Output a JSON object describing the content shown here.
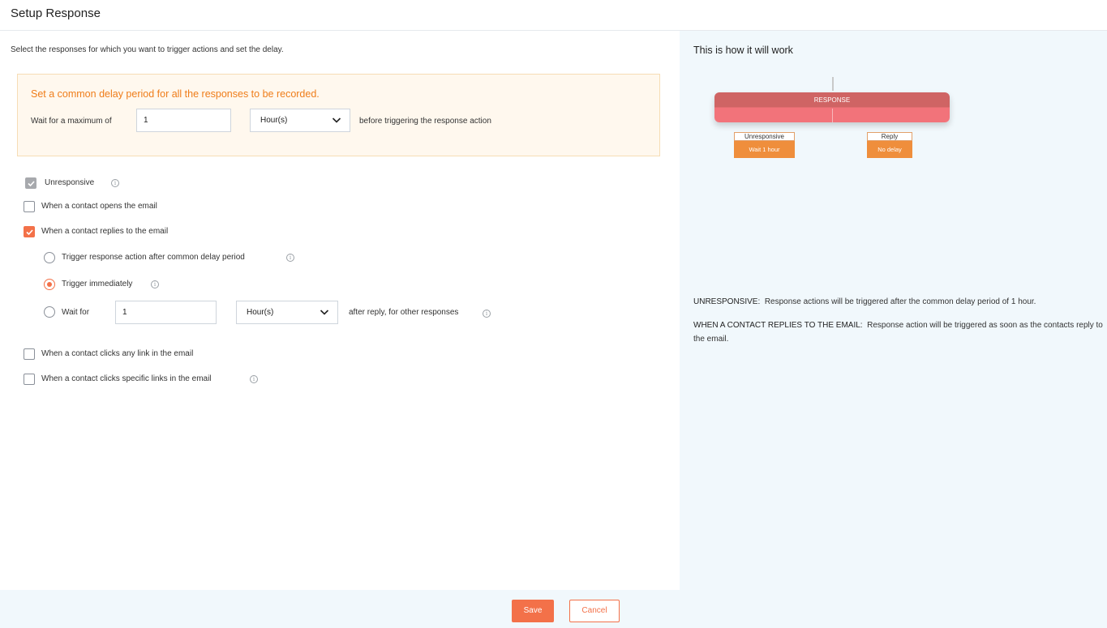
{
  "header": {
    "title": "Setup Response"
  },
  "main": {
    "intro": "Select the responses for which you want to trigger actions and set the delay.",
    "delay_box": {
      "heading": "Set a common delay period for all the responses to be recorded.",
      "wait_label": "Wait for a maximum of",
      "wait_value": "1",
      "unit_selected": "Hour(s)",
      "after_label": "before triggering the response action"
    },
    "options": {
      "unresponsive": {
        "label": "Unresponsive",
        "checked": true,
        "disabled": true
      },
      "opens": {
        "label": "When a contact opens the email",
        "checked": false
      },
      "replies": {
        "label": "When a contact replies to the email",
        "checked": true
      },
      "reply_trigger_common": {
        "label": "Trigger response action after common delay period",
        "selected": false
      },
      "reply_trigger_immediate": {
        "label": "Trigger immediately",
        "selected": true
      },
      "reply_wait": {
        "label": "Wait for",
        "value": "1",
        "unit_selected": "Hour(s)",
        "after_label": "after reply, for other responses",
        "selected": false
      },
      "clicks_any": {
        "label": "When a contact clicks any link in the email",
        "checked": false
      },
      "clicks_specific": {
        "label": "When a contact clicks specific links in the email",
        "checked": false
      }
    }
  },
  "footer": {
    "save_label": "Save",
    "cancel_label": "Cancel"
  },
  "preview": {
    "title": "This is how it will work",
    "response_label": "RESPONSE",
    "branches": [
      {
        "title": "Unresponsive",
        "delay": "Wait 1 hour"
      },
      {
        "title": "Reply",
        "delay": "No delay"
      }
    ],
    "descriptions": [
      {
        "key": "UNRESPONSIVE:",
        "text": "Response actions will be triggered after the common delay period of 1 hour."
      },
      {
        "key": "WHEN A CONTACT REPLIES TO THE EMAIL:",
        "text": "Response action will be triggered as soon as the contacts reply to the email."
      }
    ]
  },
  "colors": {
    "accent": "#f37149",
    "orange_heading": "#ef7d1a",
    "response_bar": "#e96a6f",
    "branch_fill": "#ef8e3c",
    "panel_bg": "#f1f8fc"
  },
  "icons": {
    "info": "info-circle-icon",
    "chevron": "chevron-down-icon",
    "check": "checkmark-icon"
  }
}
